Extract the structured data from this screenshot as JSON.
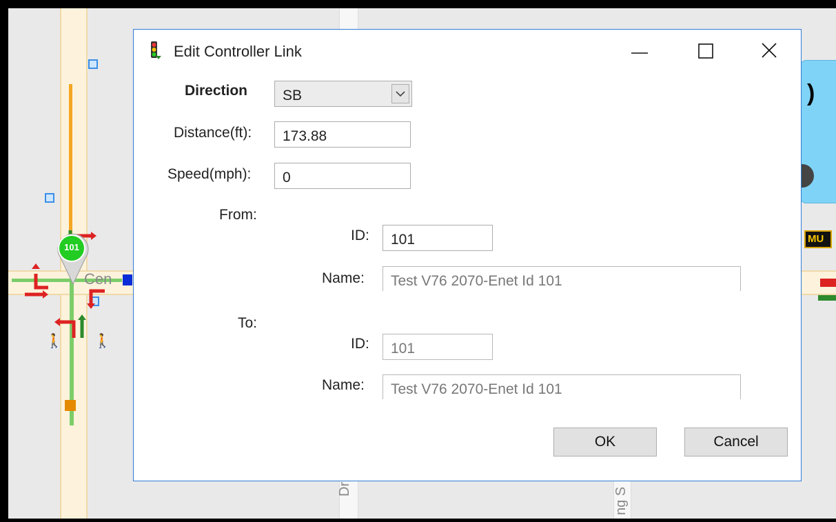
{
  "dialog": {
    "title": "Edit Controller Link",
    "direction_label": "Direction",
    "direction_value": "SB",
    "distance_label": "Distance(ft):",
    "distance_value": "173.88",
    "speed_label": "Speed(mph):",
    "speed_value": "0",
    "from_label": "From:",
    "from_id_label": "ID:",
    "from_id_value": "101",
    "from_name_label": "Name:",
    "from_name_value": "Test V76 2070-Enet  Id 101",
    "to_label": "To:",
    "to_id_label": "ID:",
    "to_id_value": "101",
    "to_name_label": "Name:",
    "to_name_value": "Test V76 2070-Enet  Id 101",
    "ok_label": "OK",
    "cancel_label": "Cancel"
  },
  "map": {
    "marker_id": "101",
    "street_fragment": "Cen",
    "street_bottom_1": "Dr",
    "street_bottom_2": "ng S",
    "badge": "MU"
  },
  "colors": {
    "accent": "#2f7bd6",
    "marker_green": "#22cc22",
    "phase_red": "#dd2222",
    "phase_green": "#2d8a2d",
    "road_fill": "#fdf3dc",
    "link_orange": "#f5a623",
    "link_green": "#7ccd6a",
    "panel_blue": "#7fd3f7"
  }
}
